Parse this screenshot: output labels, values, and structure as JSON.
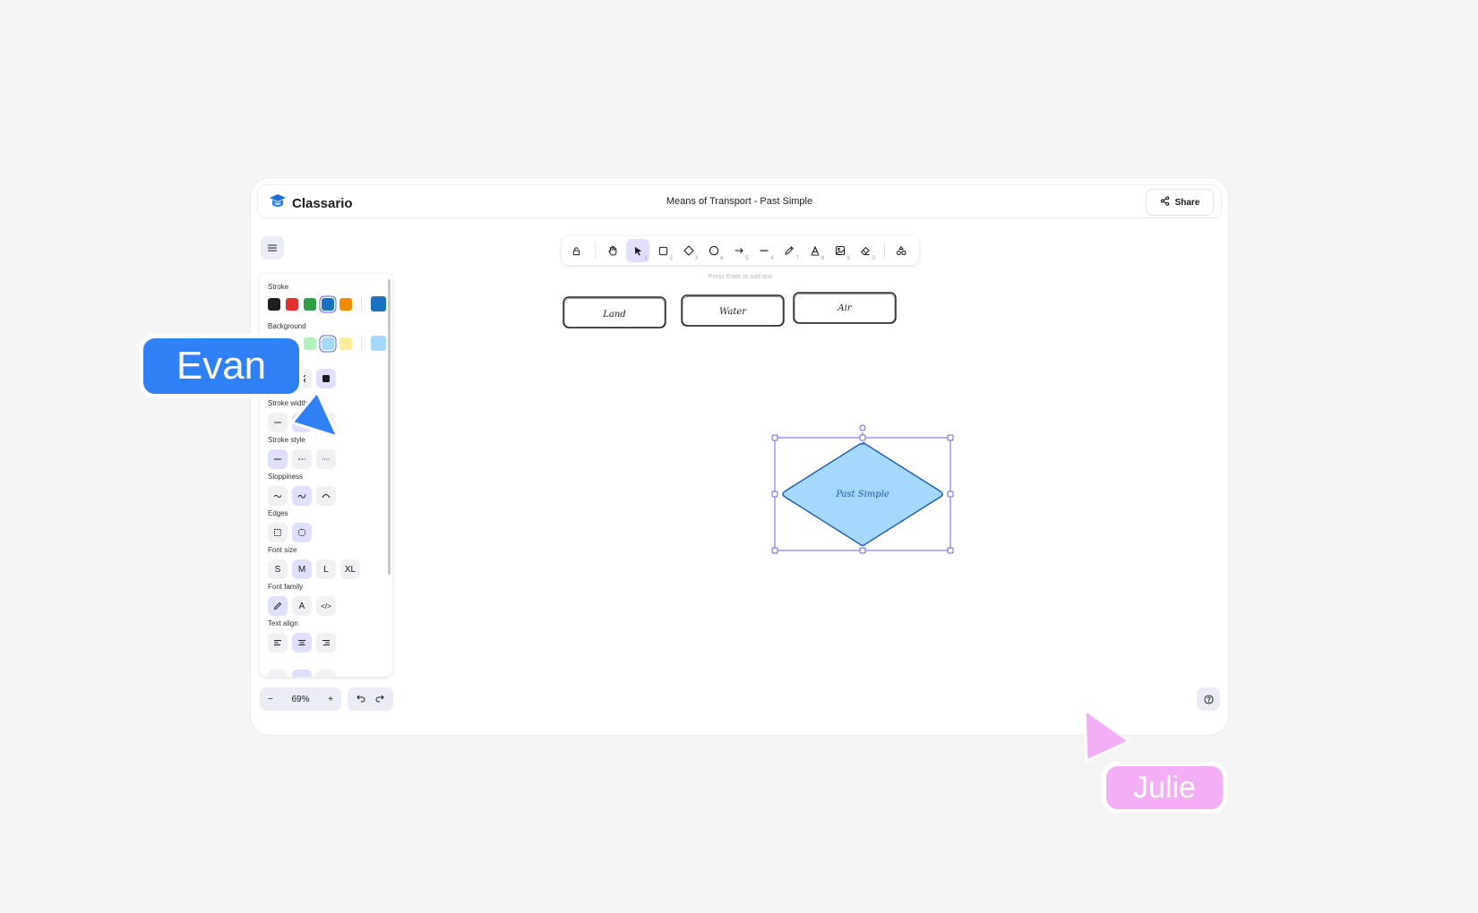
{
  "app": {
    "brand": "Classario",
    "title": "Means of Transport - Past Simple",
    "share_label": "Share"
  },
  "toolbar": {
    "tools": [
      {
        "name": "lock",
        "key": ""
      },
      {
        "name": "hand",
        "key": ""
      },
      {
        "name": "selection",
        "key": "1",
        "active": true
      },
      {
        "name": "rectangle",
        "key": "2"
      },
      {
        "name": "diamond",
        "key": "3"
      },
      {
        "name": "ellipse",
        "key": "4"
      },
      {
        "name": "arrow",
        "key": "5"
      },
      {
        "name": "line",
        "key": "6"
      },
      {
        "name": "draw",
        "key": "7"
      },
      {
        "name": "text",
        "key": "8"
      },
      {
        "name": "image",
        "key": "9"
      },
      {
        "name": "eraser",
        "key": "0"
      },
      {
        "name": "library",
        "key": ""
      }
    ],
    "hint": "Press Enter to add text"
  },
  "properties": {
    "stroke_label": "Stroke",
    "stroke_colors": [
      "#1e1e1e",
      "#e03131",
      "#2f9e44",
      "#1971c2",
      "#f08c00"
    ],
    "stroke_selected": "#1971c2",
    "background_label": "Background",
    "background_colors": [
      "#ffffff",
      "#ffc9c9",
      "#b2f2bb",
      "#a5d8ff",
      "#ffec99"
    ],
    "background_selected": "#a5d8ff",
    "stroke_width_label": "Stroke width",
    "stroke_style_label": "Stroke style",
    "sloppiness_label": "Sloppiness",
    "edges_label": "Edges",
    "font_size_label": "Font size",
    "font_sizes": [
      "S",
      "M",
      "L",
      "XL"
    ],
    "font_size_selected": "M",
    "font_family_label": "Font family",
    "font_family_options": [
      "pencil",
      "A",
      "</>"
    ],
    "text_align_label": "Text align"
  },
  "zoom": {
    "level": "69%",
    "minus": "−",
    "plus": "+"
  },
  "canvas": {
    "boxes": [
      "Land",
      "Water",
      "Air"
    ],
    "diamond_text": "Past Simple",
    "diamond_fill": "#a5d8ff",
    "diamond_stroke": "#1c58b3",
    "selection_color": "#6965db"
  },
  "collaborators": [
    {
      "name": "Evan",
      "color": "#2f7ff5"
    },
    {
      "name": "Julie",
      "color": "#f4aef5"
    }
  ]
}
